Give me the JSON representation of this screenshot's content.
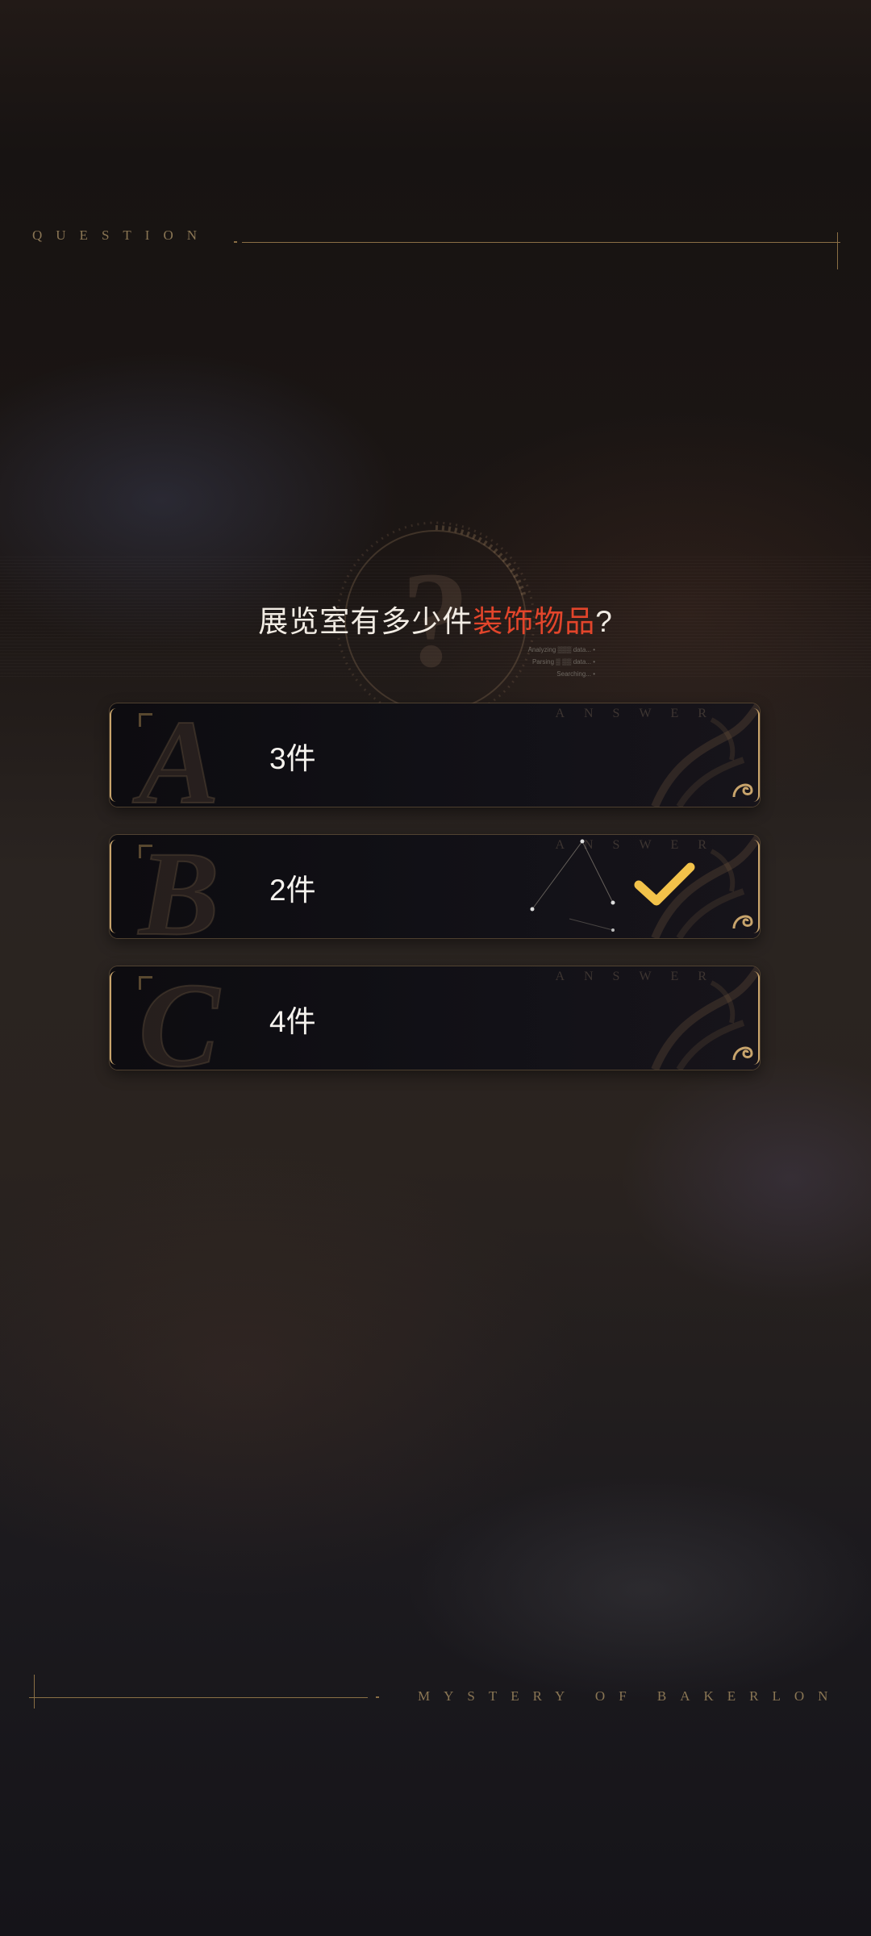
{
  "header": {
    "label": "QUESTION"
  },
  "question": {
    "prefix": "展览室有多少件",
    "highlight": "装饰物品",
    "suffix": "?",
    "scan_status": [
      "Analyzing ▒▒▒ data... •",
      "Parsing ▒ ▒▒ data... •",
      "Searching... •"
    ]
  },
  "answers": [
    {
      "letter": "A",
      "tag": "ANSWER",
      "label": "3件",
      "selected": false
    },
    {
      "letter": "B",
      "tag": "ANSWER",
      "label": "2件",
      "selected": true
    },
    {
      "letter": "C",
      "tag": "ANSWER",
      "label": "4件",
      "selected": false
    }
  ],
  "footer": {
    "label": "MYSTERY OF BAKERLON"
  },
  "colors": {
    "gold": "#c8a46c",
    "highlight": "#e2452b",
    "check": "#f2c24a"
  },
  "icons": {
    "selected": "check-icon",
    "emblem": "question-mark-emblem-icon",
    "ornament": "swirl-ornament-icon"
  }
}
